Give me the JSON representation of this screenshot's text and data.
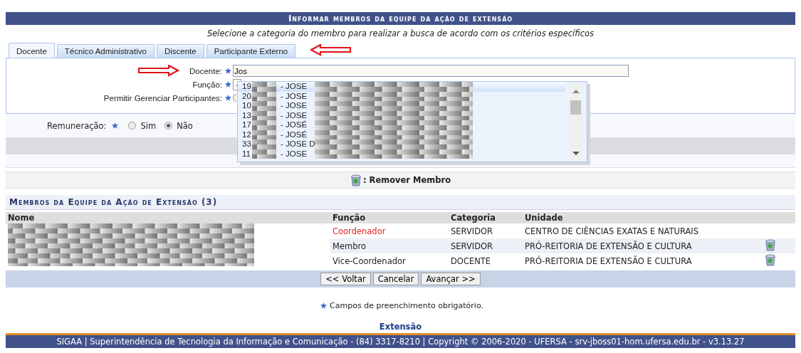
{
  "header": {
    "title": "Informar membros da equipe da ação de extensão",
    "subtitle": "Selecione a categoria do membro para realizar a busca de acordo com os critérios específicos"
  },
  "tabs": [
    {
      "label": "Docente",
      "selected": true
    },
    {
      "label": "Técnico Administrativo",
      "selected": false
    },
    {
      "label": "Discente",
      "selected": false
    },
    {
      "label": "Participante Externo",
      "selected": false
    }
  ],
  "form": {
    "fields": [
      {
        "label": "Docente:",
        "kind": "text",
        "value": "Jos"
      },
      {
        "label": "Função:",
        "kind": "select",
        "value": "-"
      },
      {
        "label": "Permitir Gerenciar Participantes:",
        "kind": "radio",
        "selected": false
      }
    ]
  },
  "suggestions": [
    {
      "code": "19",
      "name": "- JOSE",
      "selected": true
    },
    {
      "code": "20",
      "name": "- JOSE",
      "selected": false
    },
    {
      "code": "10",
      "name": "- JOSE",
      "selected": false
    },
    {
      "code": "13",
      "name": "- JOSE",
      "selected": false
    },
    {
      "code": "17",
      "name": "- JOSÉ",
      "selected": false
    },
    {
      "code": "12",
      "name": "- JOSÉ",
      "selected": false
    },
    {
      "code": "33",
      "name": "- JOSE D",
      "selected": false
    },
    {
      "code": "11",
      "name": "- JOSE",
      "selected": false
    }
  ],
  "remuneracao": {
    "label": "Remuneração:",
    "options": [
      {
        "label": "Sim",
        "selected": false
      },
      {
        "label": "Não",
        "selected": true
      }
    ]
  },
  "legend": {
    "label": ": Remover Membro"
  },
  "members": {
    "title": "Membros da Equipe da Ação de Extensão (3)",
    "columns": [
      "Nome",
      "Função",
      "Categoria",
      "Unidade"
    ],
    "rows": [
      {
        "funcao": "Coordenador",
        "categoria": "SERVIDOR",
        "unidade": "CENTRO DE CIÊNCIAS EXATAS E NATURAIS",
        "highlight": true,
        "removable": false
      },
      {
        "funcao": "Membro",
        "categoria": "SERVIDOR",
        "unidade": "PRÓ-REITORIA DE EXTENSÃO E CULTURA",
        "highlight": false,
        "removable": true
      },
      {
        "funcao": "Vice-Coordenador",
        "categoria": "DOCENTE",
        "unidade": "PRÓ-REITORIA DE EXTENSÃO E CULTURA",
        "highlight": false,
        "removable": true
      }
    ]
  },
  "buttons": [
    "<< Voltar",
    "Cancelar",
    "Avançar >>"
  ],
  "required_note": "Campos de preenchimento obrigatório.",
  "module": "Extensão",
  "footer": "SIGAA | Superintendência de Tecnologia da Informação e Comunicação - (84) 3317-8210 | Copyright © 2006-2020 - UFERSA - srv-jboss01-hom.ufersa.edu.br - v3.13.27"
}
